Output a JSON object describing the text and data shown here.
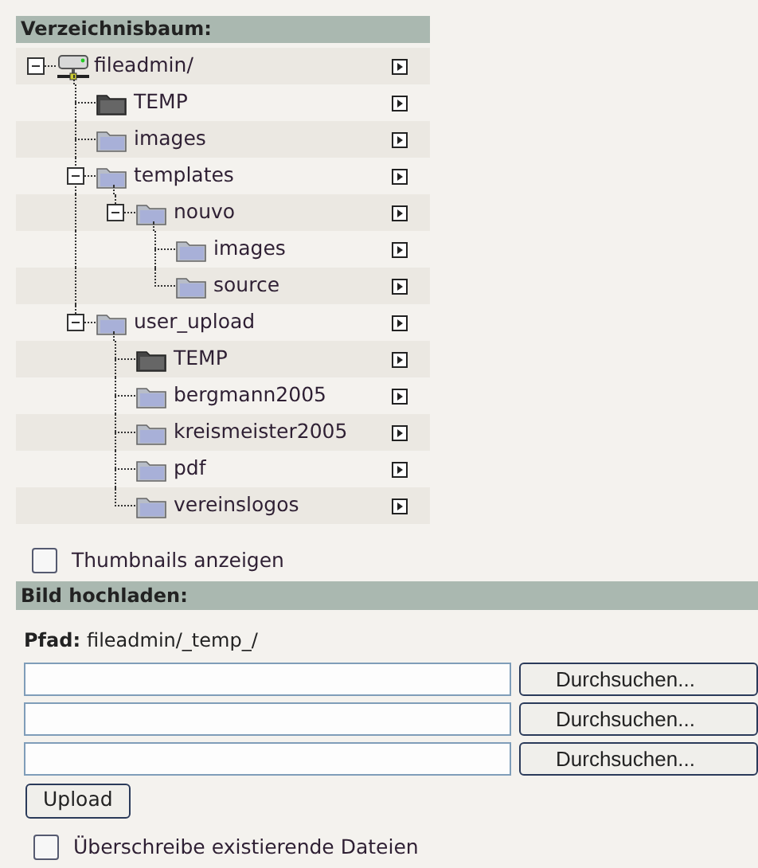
{
  "tree_section": {
    "title": "Verzeichnisbaum:"
  },
  "tree": [
    {
      "label": "fileadmin/",
      "kind": "server",
      "expanded": true,
      "children": [
        {
          "label": "TEMP",
          "kind": "temp"
        },
        {
          "label": "images",
          "kind": "folder"
        },
        {
          "label": "templates",
          "kind": "folder",
          "expanded": true,
          "children": [
            {
              "label": "nouvo",
              "kind": "folder",
              "expanded": true,
              "children": [
                {
                  "label": "images",
                  "kind": "folder"
                },
                {
                  "label": "source",
                  "kind": "folder"
                }
              ]
            }
          ]
        },
        {
          "label": "user_upload",
          "kind": "folder",
          "expanded": true,
          "children": [
            {
              "label": "TEMP",
              "kind": "temp"
            },
            {
              "label": "bergmann2005",
              "kind": "folder"
            },
            {
              "label": "kreismeister2005",
              "kind": "folder"
            },
            {
              "label": "pdf",
              "kind": "folder"
            },
            {
              "label": "vereinslogos",
              "kind": "folder"
            }
          ]
        }
      ]
    }
  ],
  "thumbnails": {
    "label": "Thumbnails anzeigen",
    "checked": false
  },
  "upload_section": {
    "title": "Bild hochladen:",
    "path_label": "Pfad:",
    "path": "fileadmin/_temp_/",
    "files": [
      {
        "button": "Durchsuchen..."
      },
      {
        "button": "Durchsuchen..."
      },
      {
        "button": "Durchsuchen..."
      }
    ],
    "upload_button": "Upload",
    "overwrite": {
      "label": "Überschreibe existierende Dateien",
      "checked": false
    }
  }
}
